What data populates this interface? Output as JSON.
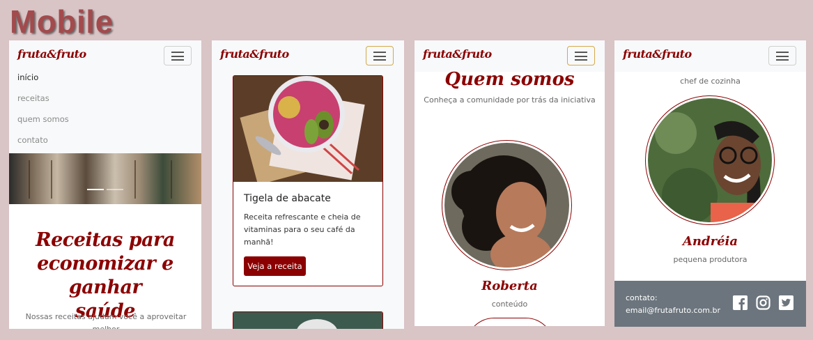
{
  "page": {
    "heading": "Mobile"
  },
  "brand": "fruta&fruto",
  "screen1": {
    "menu": [
      "início",
      "receitas",
      "quem somos",
      "contato"
    ],
    "hero_title_lines": [
      "Receitas para",
      "economizar e ganhar",
      "saúde"
    ],
    "hero_text": "Nossas receitas ajudam você a aproveitar melhor"
  },
  "screen2": {
    "card": {
      "title": "Tigela de abacate",
      "text": "Receita refrescante e cheia de vitaminas para o seu café da manhã!",
      "button": "Veja a receita"
    }
  },
  "screen3": {
    "title": "Quem somos",
    "subtitle": "Conheça a comunidade por trás da iniciativa",
    "person": {
      "name": "Roberta",
      "role": "conteúdo"
    }
  },
  "screen4": {
    "top_role": "chef de cozinha",
    "person": {
      "name": "Andréia",
      "role": "pequena produtora"
    },
    "footer": {
      "label": "contato:",
      "email": "email@frutafruto.com.br",
      "social_icons": [
        "facebook-icon",
        "instagram-icon",
        "twitter-icon"
      ]
    }
  },
  "colors": {
    "brand": "#8b0000",
    "page_bg": "#d9c4c6",
    "navbar_bg": "#f8f9fa",
    "footer_bg": "#6c757d"
  }
}
